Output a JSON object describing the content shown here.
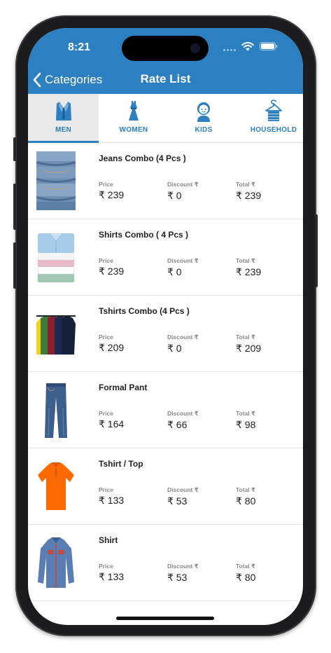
{
  "status_bar": {
    "time": "8:21"
  },
  "nav": {
    "back_label": "Categories",
    "title": "Rate List"
  },
  "tabs": [
    {
      "label": "MEN",
      "icon": "suit-icon",
      "active": true
    },
    {
      "label": "WOMEN",
      "icon": "dress-icon",
      "active": false
    },
    {
      "label": "KIDS",
      "icon": "kid-icon",
      "active": false
    },
    {
      "label": "HOUSEHOLD",
      "icon": "hanger-icon",
      "active": false
    }
  ],
  "columns": {
    "price": "Price",
    "discount": "Discount ₹",
    "total": "Total ₹"
  },
  "items": [
    {
      "name": "Jeans Combo (4 Pcs )",
      "price": "₹ 239",
      "discount": "₹ 0",
      "total": "₹ 239",
      "image": "folded-jeans-image"
    },
    {
      "name": "Shirts Combo ( 4 Pcs )",
      "price": "₹ 239",
      "discount": "₹ 0",
      "total": "₹ 239",
      "image": "folded-shirts-image"
    },
    {
      "name": "Tshirts Combo (4 Pcs )",
      "price": "₹ 209",
      "discount": "₹ 0",
      "total": "₹ 209",
      "image": "tshirts-image"
    },
    {
      "name": "Formal Pant",
      "price": "₹ 164",
      "discount": "₹ 66",
      "total": "₹ 98",
      "image": "pant-image"
    },
    {
      "name": "Tshirt / Top",
      "price": "₹ 133",
      "discount": "₹ 53",
      "total": "₹ 80",
      "image": "orange-polo-image"
    },
    {
      "name": "Shirt",
      "price": "₹ 133",
      "discount": "₹ 53",
      "total": "₹ 80",
      "image": "denim-shirt-image"
    }
  ],
  "colors": {
    "primary": "#2c7fc1",
    "active_tab_bg": "#e9e9e9"
  }
}
